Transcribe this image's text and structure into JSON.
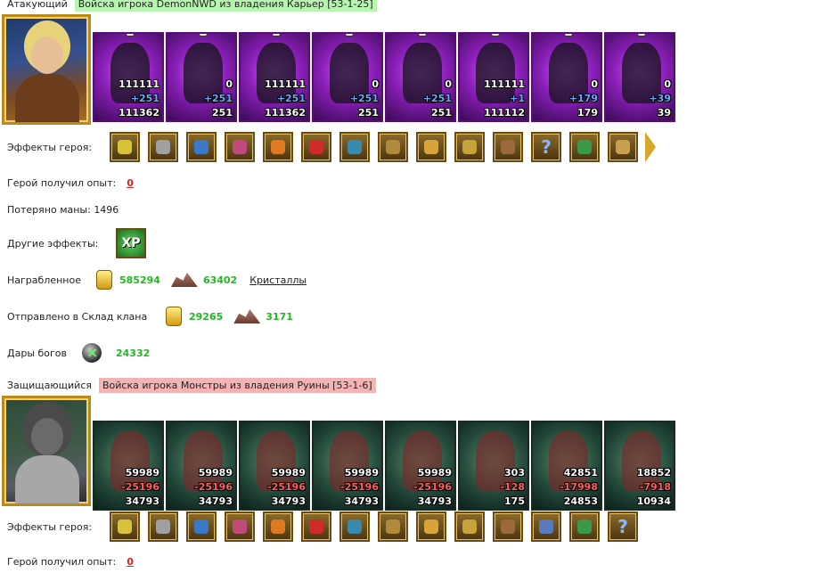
{
  "attacker": {
    "label": "Атакующий",
    "title": "Войска игрока DemonNWD из владения Карьер [53-1-25]",
    "units": [
      {
        "count": "111111",
        "delta": "+251",
        "total": "111362"
      },
      {
        "count": "0",
        "delta": "+251",
        "total": "251"
      },
      {
        "count": "111111",
        "delta": "+251",
        "total": "111362"
      },
      {
        "count": "0",
        "delta": "+251",
        "total": "251"
      },
      {
        "count": "0",
        "delta": "+251",
        "total": "251"
      },
      {
        "count": "111111",
        "delta": "+1",
        "total": "111112"
      },
      {
        "count": "0",
        "delta": "+179",
        "total": "179"
      },
      {
        "count": "0",
        "delta": "+39",
        "total": "39"
      }
    ],
    "effects_label": "Эффекты героя:",
    "effects": [
      "crystal-icon",
      "armor-icon",
      "gem-bag-icon",
      "chest-icon",
      "treasure-icon",
      "heart-icon",
      "shield-icon",
      "scroll-icon",
      "amulet-icon",
      "gloves-icon",
      "wings-icon",
      "question-icon",
      "totem-icon",
      "gauntlet-icon"
    ],
    "exp_label": "Герой получил опыт:",
    "exp_value": "0",
    "mana_text": "Потеряно маны: 1496",
    "other_effects_label": "Другие эффекты:",
    "xp_badge": "XP",
    "loot_label": "Награбленное",
    "loot_gold": "585294",
    "loot_ore": "63402",
    "loot_link": "Кристаллы",
    "clan_label": "Отправлено в Склад клана",
    "clan_gold": "29265",
    "clan_ore": "3171",
    "gods_label": "Дары богов",
    "gods_value": "24332"
  },
  "defender": {
    "label": "Защищающийся",
    "title": "Войска игрока Монстры из владения Руины [53-1-6]",
    "units": [
      {
        "count": "59989",
        "delta": "-25196",
        "total": "34793"
      },
      {
        "count": "59989",
        "delta": "-25196",
        "total": "34793"
      },
      {
        "count": "59989",
        "delta": "-25196",
        "total": "34793"
      },
      {
        "count": "59989",
        "delta": "-25196",
        "total": "34793"
      },
      {
        "count": "59989",
        "delta": "-25196",
        "total": "34793"
      },
      {
        "count": "303",
        "delta": "-128",
        "total": "175"
      },
      {
        "count": "42851",
        "delta": "-17998",
        "total": "24853"
      },
      {
        "count": "18852",
        "delta": "-7918",
        "total": "10934"
      }
    ],
    "effects_label": "Эффекты героя:",
    "effects": [
      "helmet-icon",
      "ice-arrow-icon",
      "shield-icon",
      "beast-icon",
      "staff-icon",
      "no-sign-icon",
      "dragon-head-icon",
      "ice-crystal-icon",
      "ice-armor-icon",
      "ice-ring-icon",
      "ice-sword-icon",
      "ice-axe-icon",
      "trident-icon",
      "question-icon"
    ],
    "exp_label": "Герой получил опыт:",
    "exp_value": "0"
  }
}
